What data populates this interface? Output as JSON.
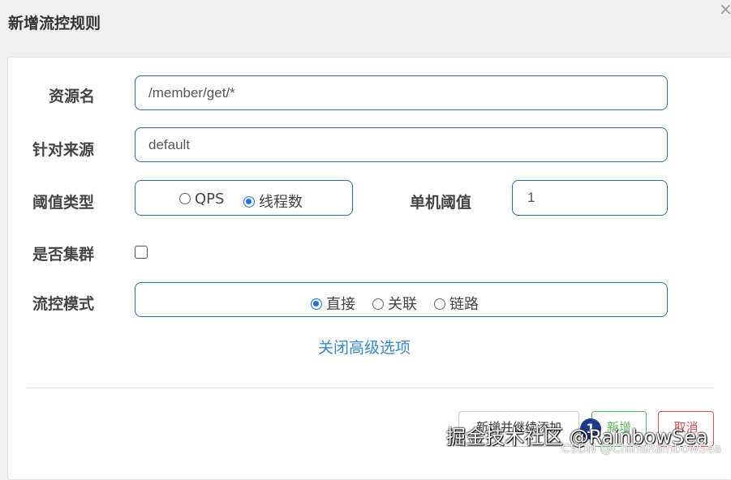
{
  "dialog": {
    "title": "新增流控规则",
    "close_glyph": "×"
  },
  "form": {
    "resource": {
      "label": "资源名",
      "value": "/member/get/*"
    },
    "limit_app": {
      "label": "针对来源",
      "value": "default"
    },
    "grade": {
      "label": "阈值类型",
      "options": [
        {
          "label": "QPS",
          "checked": false
        },
        {
          "label": "线程数",
          "checked": true
        }
      ]
    },
    "count": {
      "label": "单机阈值",
      "value": "1"
    },
    "cluster": {
      "label": "是否集群",
      "checked": false
    },
    "strategy": {
      "label": "流控模式",
      "options": [
        {
          "label": "直接",
          "checked": true
        },
        {
          "label": "关联",
          "checked": false
        },
        {
          "label": "链路",
          "checked": false
        }
      ]
    },
    "advanced_link": "关闭高级选项"
  },
  "footer": {
    "add_continue": "新增并继续添加",
    "add": "新增",
    "cancel": "取消"
  },
  "overlay": {
    "badge_number": "1",
    "watermark_main": "掘金技术社区 @RainbowSea",
    "watermark_sub": "CSDN @ChinaRainbowSea"
  },
  "colors": {
    "border_accent": "#2f6f9a",
    "radio_checked": "#1a73e8",
    "link": "#3a86c8",
    "add_green": "#5cb85c",
    "cancel_red": "#d9534f"
  }
}
